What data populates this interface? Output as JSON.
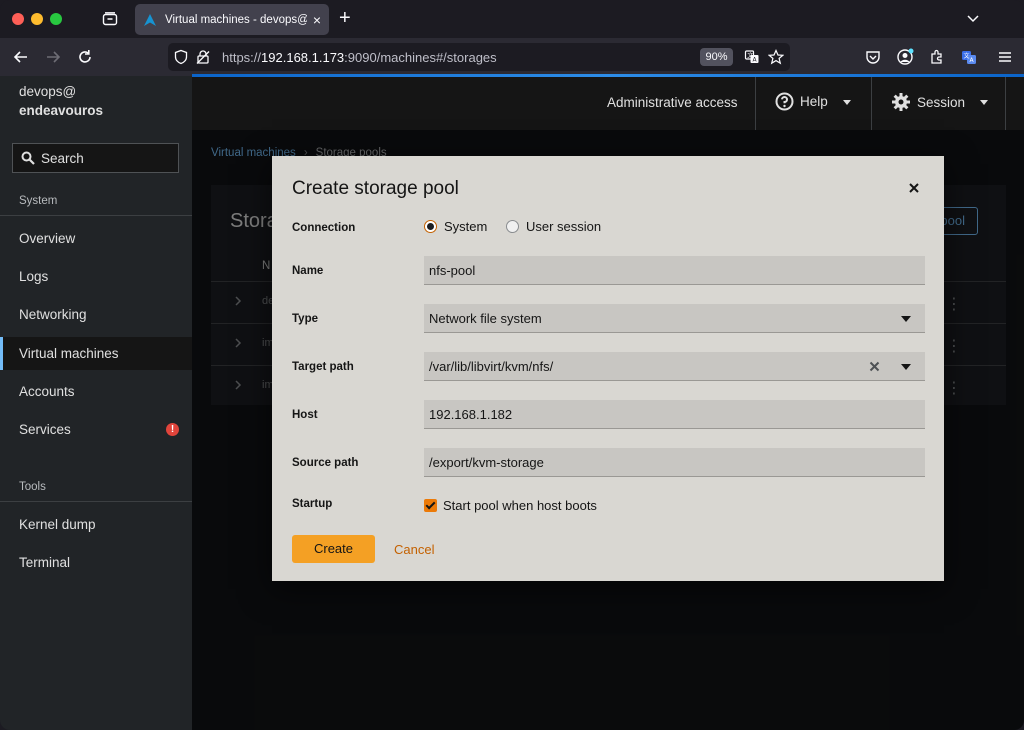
{
  "browser": {
    "tab_title": "Virtual machines - devops@endeavouros",
    "url_prefix": "https://",
    "url_host": "192.168.1.173",
    "url_path": ":9090/machines#/storages",
    "zoom": "90%"
  },
  "sidebar": {
    "host_user": "devops@",
    "host_name": "endeavouros",
    "search_label": "Search",
    "section_system": "System",
    "items_system": [
      {
        "label": "Overview"
      },
      {
        "label": "Logs"
      },
      {
        "label": "Networking"
      },
      {
        "label": "Virtual machines",
        "active": true
      },
      {
        "label": "Accounts"
      },
      {
        "label": "Services",
        "alert": "!"
      }
    ],
    "section_tools": "Tools",
    "items_tools": [
      {
        "label": "Kernel dump"
      },
      {
        "label": "Terminal"
      }
    ]
  },
  "header": {
    "admin_access": "Administrative access",
    "help": "Help",
    "session": "Session"
  },
  "page": {
    "breadcrumb": [
      "Virtual machines",
      "Storage pools"
    ],
    "card_title": "Stora",
    "card_button": "pool",
    "column_initial": "N",
    "row_texts": [
      "de",
      "im",
      "im"
    ]
  },
  "modal": {
    "title": "Create storage pool",
    "connection_label": "Connection",
    "connection_options": [
      "System",
      "User session"
    ],
    "connection_selected": "System",
    "name_label": "Name",
    "name_value": "nfs-pool",
    "type_label": "Type",
    "type_value": "Network file system",
    "target_label": "Target path",
    "target_value": "/var/lib/libvirt/kvm/nfs/",
    "host_label": "Host",
    "host_value": "192.168.1.182",
    "source_label": "Source path",
    "source_value": "/export/kvm-storage",
    "startup_label": "Startup",
    "startup_checkbox": "Start pool when host boots",
    "startup_checked": true,
    "create_label": "Create",
    "cancel_label": "Cancel"
  },
  "colors": {
    "accent_orange": "#f4a024",
    "link_blue": "#73bcf7",
    "alert_red": "#e0443b"
  }
}
